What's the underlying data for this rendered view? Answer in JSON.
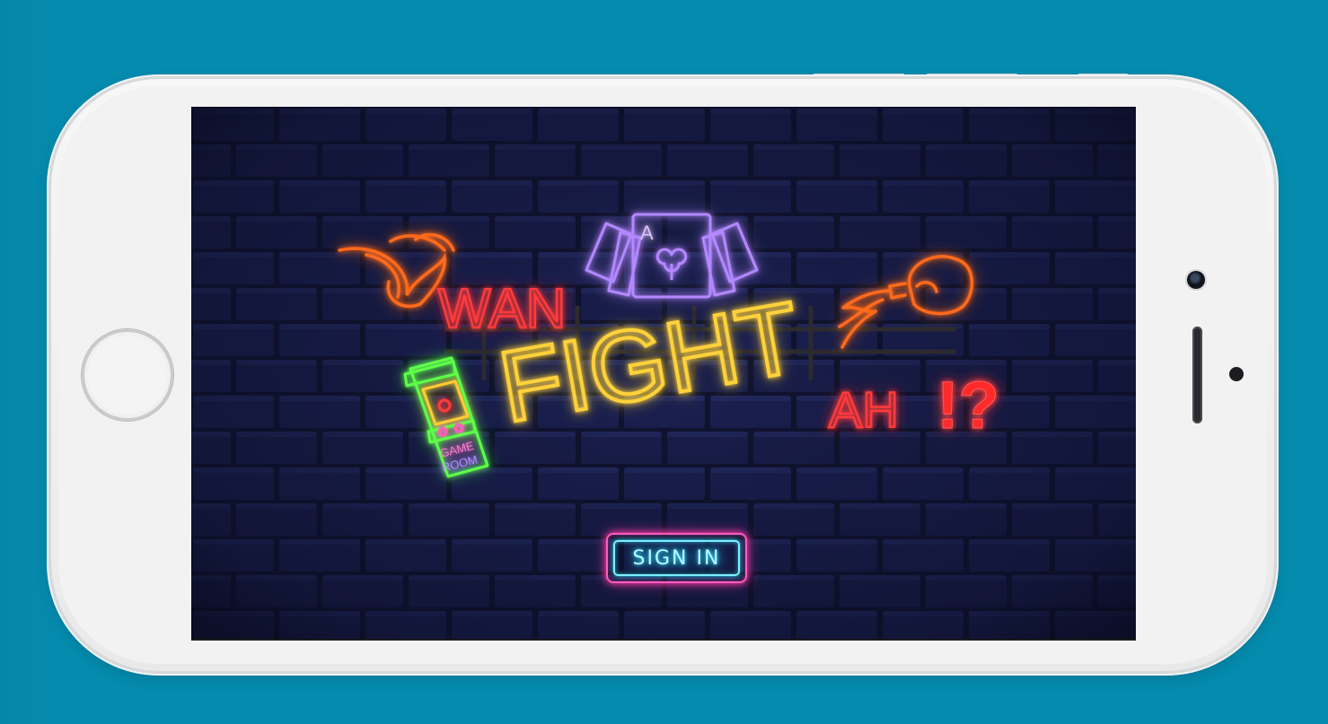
{
  "app": {
    "title_word_1": "WAN",
    "title_word_2": "FIGHT",
    "title_word_3": "AH",
    "title_punct": "!?",
    "card_letter": "A",
    "arcade_label_line_1": "GAME",
    "arcade_label_line_2": "ROOM"
  },
  "login": {
    "sign_in_label": "SIGN IN"
  },
  "colors": {
    "background": "#058bae",
    "wall": "#171c48",
    "neon_orange": "#ffb020",
    "neon_red": "#ff3b3b",
    "neon_purple": "#b388ff",
    "neon_green": "#5dff4a",
    "neon_cyan": "#7ff0ff",
    "neon_pink": "#ff5dbb"
  },
  "icons": [
    "fire-icon",
    "playing-cards-icon",
    "boxing-glove-icon",
    "arcade-machine-icon"
  ]
}
